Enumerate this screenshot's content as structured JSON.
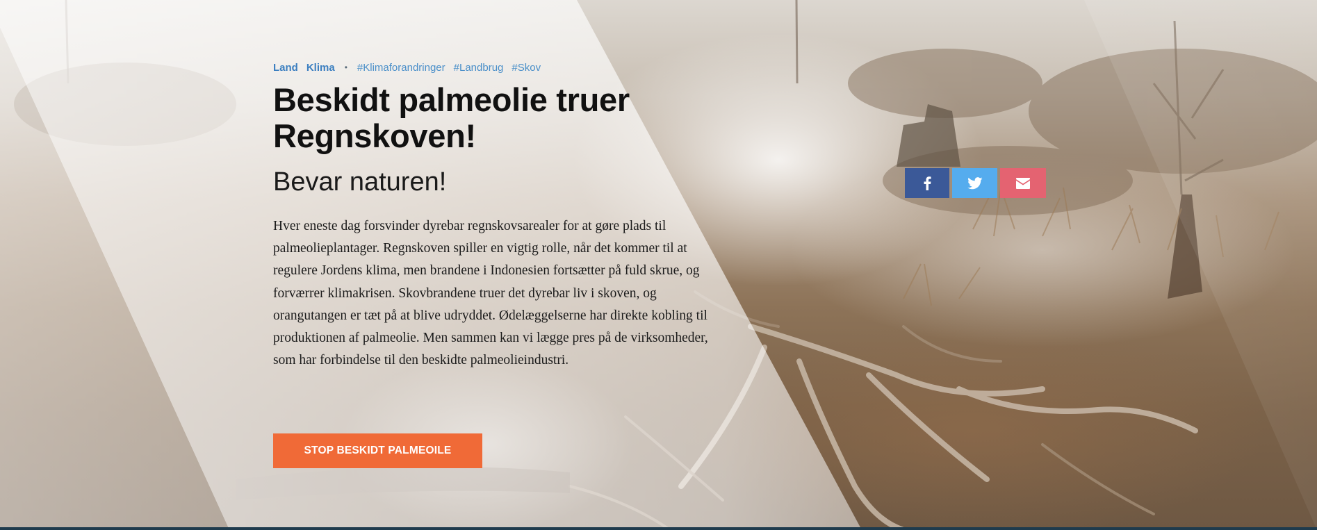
{
  "article": {
    "categories": [
      "Land",
      "Klima"
    ],
    "separator": "•",
    "hashtags": [
      "#Klimaforandringer",
      "#Landbrug",
      "#Skov"
    ],
    "title": "Beskidt palmeolie truer Regnskoven!",
    "subtitle": "Bevar naturen!",
    "body": "Hver eneste dag forsvinder dyrebar regnskovsarealer for at gøre plads til palmeolieplantager. Regnskoven spiller en vigtig rolle, når det kommer til at regulere Jordens klima, men brandene i Indonesien fortsætter på fuld skrue, og forværrer klimakrisen. Skovbrandene truer det dyrebar liv i skoven, og orangutangen er tæt på at blive udryddet. Ødelæggelserne har direkte kobling til produktionen af palmeolie. Men sammen kan vi lægge pres på de virksomheder, som har forbindelse til den beskidte palmeolieindustri.",
    "cta_label": "STOP BESKIDT PALMEOILE"
  },
  "share": {
    "facebook_icon": "facebook-icon",
    "twitter_icon": "twitter-icon",
    "email_icon": "envelope-icon",
    "colors": {
      "facebook": "#3b5998",
      "twitter": "#55acee",
      "email": "#e46371"
    }
  },
  "colors": {
    "accent": "#f06a37",
    "tag_link": "#4a8fc9",
    "bottom_bar": "#1f3b4d"
  }
}
